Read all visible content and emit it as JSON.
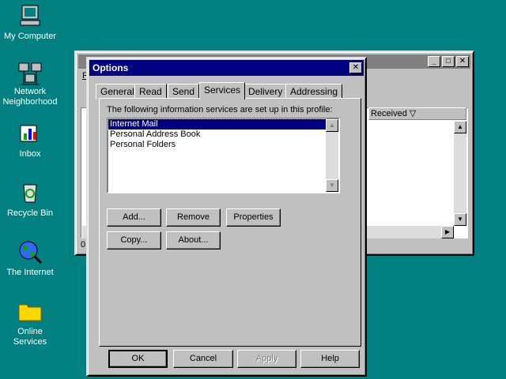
{
  "desktop": {
    "icons": [
      {
        "label": "My Computer"
      },
      {
        "label": "Network\nNeighborhood"
      },
      {
        "label": "Inbox"
      },
      {
        "label": "Recycle Bin"
      },
      {
        "label": "The Internet"
      },
      {
        "label": "Online\nServices"
      }
    ]
  },
  "background_window": {
    "menu_first": "F",
    "column_received": "Received ▽",
    "status": "0"
  },
  "dialog": {
    "title": "Options",
    "close_glyph": "✕",
    "tabs": [
      "General",
      "Read",
      "Send",
      "Services",
      "Delivery",
      "Addressing"
    ],
    "active_tab": "Services",
    "description": "The following information services are set up in this profile:",
    "services": [
      "Internet Mail",
      "Personal Address Book",
      "Personal Folders"
    ],
    "selected_service": "Internet Mail",
    "buttons": {
      "add": "Add...",
      "remove": "Remove",
      "properties": "Properties",
      "copy": "Copy...",
      "about": "About...",
      "ok": "OK",
      "cancel": "Cancel",
      "apply": "Apply",
      "help": "Help"
    }
  },
  "colors": {
    "desktop": "#008080",
    "active_title": "#000080",
    "inactive_title": "#808080",
    "face": "#c0c0c0"
  }
}
